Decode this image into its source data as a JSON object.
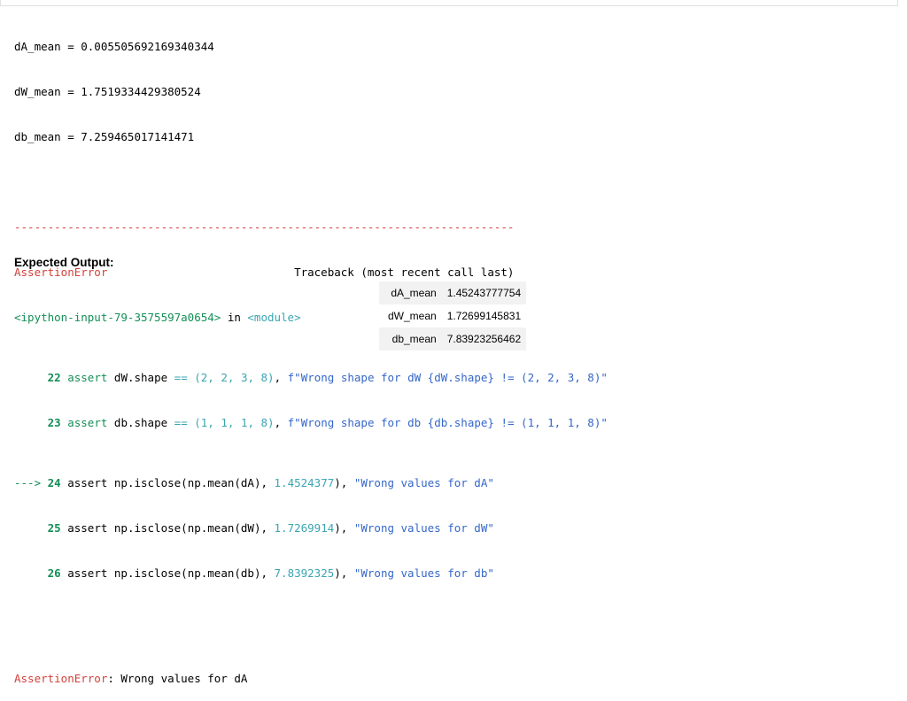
{
  "stdout": {
    "line1": "dA_mean = 0.005505692169340344",
    "line2": "dW_mean = 1.7519334429380524",
    "line3": "db_mean = 7.259465017141471"
  },
  "traceback": {
    "dashes": "---------------------------------------------------------------------------",
    "error_name": "AssertionError",
    "header_spacer": "                            ",
    "header_text": "Traceback (most recent call last)",
    "input_ref": "<ipython-input-79-3575597a0654>",
    "in_text": " in ",
    "module": "<module>",
    "lines": [
      {
        "prefix": "     ",
        "num": "22",
        "kw": " assert ",
        "var": "dW",
        "attr": ".shape ",
        "op": "==",
        "tuple": " (2, 2, 3, 8)",
        "comma": ", ",
        "fstr": "f\"Wrong shape for dW {dW.shape} != (2, 2, 3, 8)\""
      },
      {
        "prefix": "     ",
        "num": "23",
        "kw": " assert ",
        "var": "db",
        "attr": ".shape ",
        "op": "==",
        "tuple": " (1, 1, 1, 8)",
        "comma": ", ",
        "fstr": "f\"Wrong shape for db {db.shape} != (1, 1, 1, 8)\""
      }
    ],
    "iscloses": [
      {
        "prefix": "---> ",
        "num": "24",
        "code": " assert np.isclose(np.mean(dA), ",
        "num_val": "1.4524377",
        "close": "), ",
        "msg": "\"Wrong values for dA\""
      },
      {
        "prefix": "     ",
        "num": "25",
        "code": " assert np.isclose(np.mean(dW), ",
        "num_val": "1.7269914",
        "close": "), ",
        "msg": "\"Wrong values for dW\""
      },
      {
        "prefix": "     ",
        "num": "26",
        "code": " assert np.isclose(np.mean(db), ",
        "num_val": "7.8392325",
        "close": "), ",
        "msg": "\"Wrong values for db\""
      }
    ],
    "final_error": "AssertionError",
    "final_message": ": Wrong values for dA"
  },
  "expected": {
    "title": "Expected Output:",
    "rows": [
      {
        "key": "dA_mean",
        "value": "1.45243777754"
      },
      {
        "key": "dW_mean",
        "value": "1.72699145831"
      },
      {
        "key": "db_mean",
        "value": "7.83923256462"
      }
    ]
  },
  "colors": {
    "error_red": "#d2413a",
    "line_green": "#148e56",
    "number_teal": "#3ba5b2",
    "string_blue": "#3567c9"
  }
}
